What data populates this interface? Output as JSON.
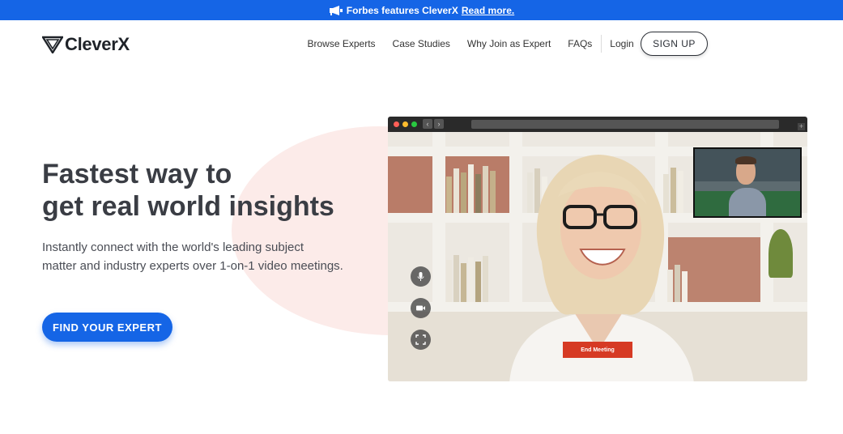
{
  "banner": {
    "text": "Forbes features CleverX",
    "link": "Read more.",
    "icon": "megaphone-icon"
  },
  "brand": {
    "name": "CleverX",
    "icon": "cleverx-logo-icon"
  },
  "nav": {
    "items": [
      "Browse Experts",
      "Case Studies",
      "Why Join as Expert",
      "FAQs"
    ],
    "login": "Login",
    "signup": "SIGN UP"
  },
  "hero": {
    "title_line1": "Fastest way to",
    "title_line2": "get real world insights",
    "subtitle_line1": "Instantly connect with the world's leading subject",
    "subtitle_line2": "matter and industry experts over 1-on-1 video meetings.",
    "cta": "FIND YOUR EXPERT"
  },
  "video": {
    "end_meeting": "End Meeting",
    "controls": [
      "microphone-icon",
      "video-camera-icon",
      "fullscreen-icon"
    ]
  },
  "colors": {
    "brand_blue": "#1565e6",
    "blob_pink": "#fcebe9",
    "end_red": "#d63a24",
    "text_dark": "#3a3d44"
  }
}
